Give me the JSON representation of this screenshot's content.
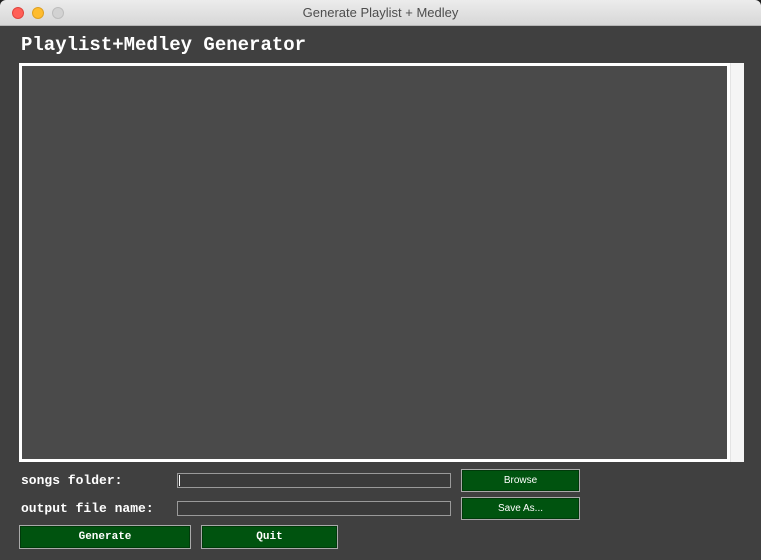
{
  "window": {
    "title": "Generate Playlist + Medley"
  },
  "app": {
    "heading": "Playlist+Medley Generator"
  },
  "output_area": {
    "content": ""
  },
  "songs_folder": {
    "label": "songs folder:",
    "value": "",
    "browse_label": "Browse"
  },
  "output_file": {
    "label": "output file name:",
    "value": "",
    "save_as_label": "Save As..."
  },
  "actions": {
    "generate_label": "Generate",
    "quit_label": "Quit"
  },
  "colors": {
    "window_bg": "#404040",
    "text_area_bg": "#4a4a4a",
    "button_bg": "#00530f",
    "text": "#ffffff"
  }
}
